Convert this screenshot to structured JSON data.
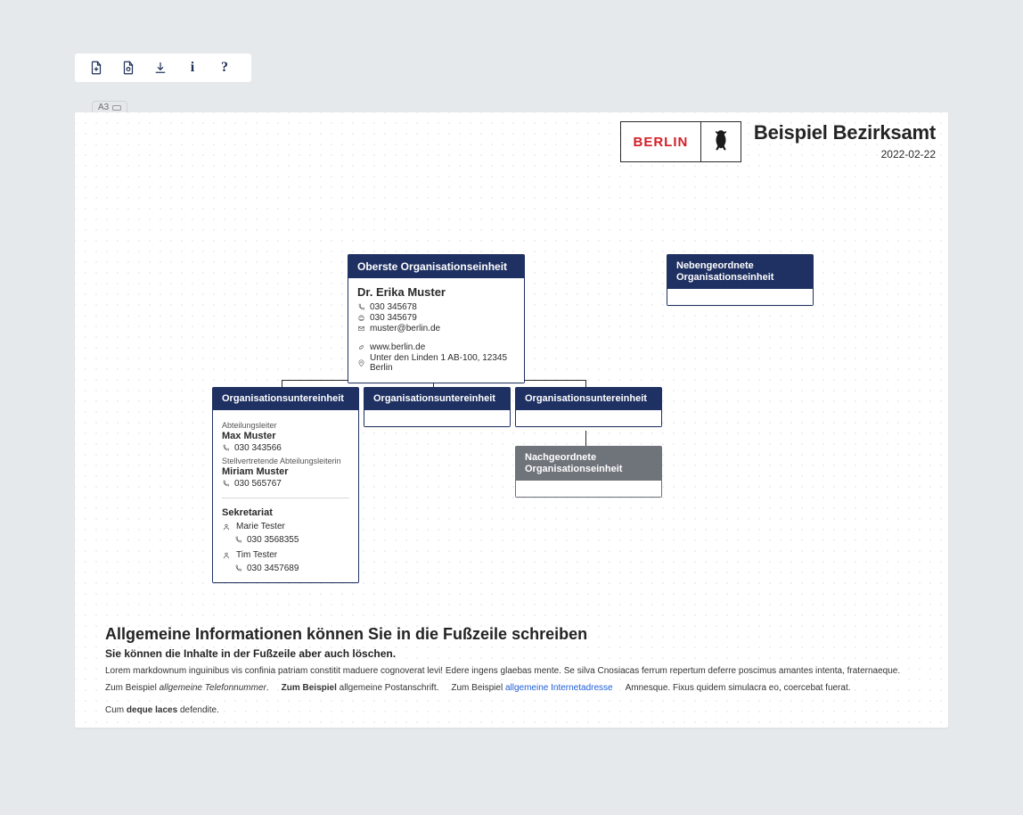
{
  "toolbar": {
    "icons": [
      "add-document",
      "duplicate-document",
      "download",
      "info",
      "help"
    ]
  },
  "paper": {
    "size": "A3"
  },
  "header": {
    "logo_text": "BERLIN",
    "title": "Beispiel Bezirksamt",
    "date": "2022-02-22"
  },
  "org": {
    "root": {
      "title": "Oberste Organisationseinheit",
      "person": "Dr. Erika Muster",
      "phone": "030 345678",
      "fax": "030 345679",
      "email": "muster@berlin.de",
      "web": "www.berlin.de",
      "address": "Unter den Linden 1 AB-100, 12345 Berlin"
    },
    "side": {
      "line1": "Nebengeordnete",
      "line2": "Organisationseinheit"
    },
    "children": [
      {
        "title": "Organisationsuntereinheit",
        "leader_role": "Abteilungsleiter",
        "leader_name": "Max Muster",
        "leader_phone": "030 343566",
        "deputy_role": "Stellvertretende Abteilungsleiterin",
        "deputy_name": "Miriam Muster",
        "deputy_phone": "030 565767",
        "section_title": "Sekretariat",
        "staff": [
          {
            "name": "Marie Tester",
            "phone": "030 3568355"
          },
          {
            "name": "Tim Tester",
            "phone": "030 3457689"
          }
        ]
      },
      {
        "title": "Organisationsuntereinheit"
      },
      {
        "title": "Organisationsuntereinheit"
      }
    ],
    "sub": {
      "line1": "Nachgeordnete",
      "line2": "Organisationseinheit"
    }
  },
  "footer": {
    "h2": "Allgemeine Informationen können Sie in die Fußzeile schreiben",
    "h3": "Sie können die Inhalte in der Fußzeile aber auch löschen.",
    "para": "Lorem markdownum inguinibus vis confinia patriam constitit maduere cognoverat levi! Edere ingens glaebas mente. Se silva Cnosiacas ferrum repertum deferre poscimus amantes intenta, fraternaeque.",
    "items": {
      "a_pre": "Zum Beispiel ",
      "a_em": "allgemeine Telefonnummer",
      "a_post": ".",
      "b_pre": "Zum Beispiel ",
      "b_strong_inner": "",
      "b_strong": "Zum Beispiel",
      "b_rest": " allgemeine Postanschrift.",
      "c_pre": "Zum Beispiel ",
      "c_link": "allgemeine Internetadresse",
      "d": "Amnesque. Fixus quidem simulacra eo, coercebat fuerat.",
      "e_pre": "Cum ",
      "e_strong": "deque laces",
      "e_post": " defendite."
    }
  }
}
